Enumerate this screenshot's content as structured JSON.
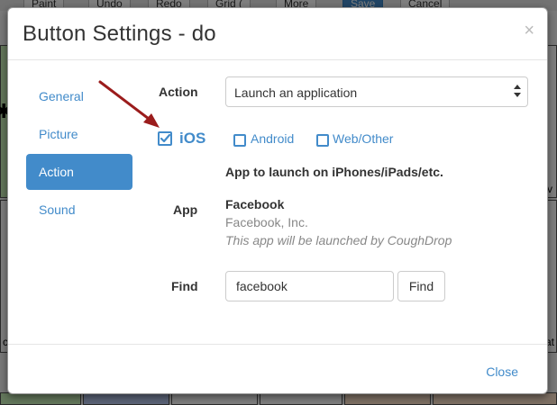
{
  "background": {
    "toolbar_buttons": [
      "Paint",
      "Undo",
      "Redo",
      "Grid (",
      "More",
      "Save",
      "Cancel"
    ],
    "tile_edge_labels": [
      "v",
      "c",
      "at"
    ]
  },
  "dialog": {
    "title": "Button Settings - do",
    "close_icon": "×",
    "tabs": [
      "General",
      "Picture",
      "Action",
      "Sound"
    ],
    "active_tab": "Action",
    "action_label": "Action",
    "action_select": {
      "selected": "Launch an application",
      "options": [
        "Launch an application"
      ]
    },
    "platforms": [
      {
        "label": "iOS",
        "checked": true
      },
      {
        "label": "Android",
        "checked": false
      },
      {
        "label": "Web/Other",
        "checked": false
      }
    ],
    "platform_heading": "App to launch on iPhones/iPads/etc.",
    "app_label": "App",
    "app": {
      "name": "Facebook",
      "author": "Facebook, Inc.",
      "note": "This app will be launched by CoughDrop"
    },
    "find_label": "Find",
    "find_value": "facebook",
    "find_button": "Find",
    "footer_close": "Close"
  },
  "colors": {
    "accent": "#428bca",
    "annotation_arrow": "#9b1c1c"
  }
}
